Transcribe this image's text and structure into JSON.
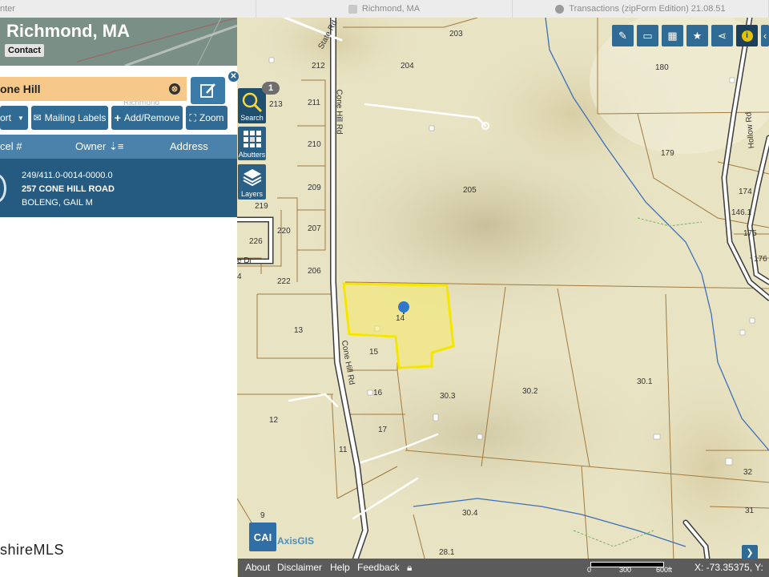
{
  "browser": {
    "tabs": [
      {
        "label": "nter"
      },
      {
        "label": "Richmond, MA"
      },
      {
        "label": "Transactions (zipForm Edition) 21.08.51"
      }
    ]
  },
  "header": {
    "title": "Richmond, MA",
    "contact_label": "Contact"
  },
  "search": {
    "query": "one Hill",
    "clear_glyph": "⊗"
  },
  "toolbar": {
    "report_label": "ort",
    "mailing_labels": "Mailing Labels",
    "add_remove": "Add/Remove",
    "zoom": "Zoom"
  },
  "columns": {
    "parcel": "cel #",
    "owner": "Owner",
    "address": "Address"
  },
  "result": {
    "parcel_id": "249/411.0-0014-0000.0",
    "street": "257 CONE HILL ROAD",
    "owner": "BOLENG, GAIL M"
  },
  "side_tools": {
    "search": "Search",
    "abutters": "Abutters",
    "layers": "Layers",
    "badge_count": "1"
  },
  "map": {
    "roads": [
      "State Rd",
      "Cone Hill Rd",
      "Cone Hill Rd",
      "Hollow Rd",
      "e Dr"
    ],
    "parcels": [
      "203",
      "212",
      "204",
      "180",
      "213",
      "211",
      "179",
      "210",
      "205",
      "174",
      "209",
      "219",
      "146.1",
      "220",
      "175",
      "207",
      "226",
      "176",
      "206",
      "4",
      "222",
      "14",
      "13",
      "15",
      "16",
      "30.3",
      "30.2",
      "30.1",
      "12",
      "17",
      "11",
      "32",
      "30.4",
      "31",
      "9",
      "28.1"
    ],
    "watermark_small": "Richmond"
  },
  "brand": {
    "mls": "shireMLS",
    "cai": "CAI",
    "axis": "AxisGIS"
  },
  "bottom": {
    "about": "About",
    "disclaimer": "Disclaimer",
    "help": "Help",
    "feedback": "Feedback",
    "scale_0": "0",
    "scale_300": "300",
    "scale_600": "600ft",
    "coords": "X: -73.35375, Y:"
  },
  "colors": {
    "accent": "#2f6b94",
    "selection": "#f5e600",
    "search_bg": "#f6c98a"
  }
}
